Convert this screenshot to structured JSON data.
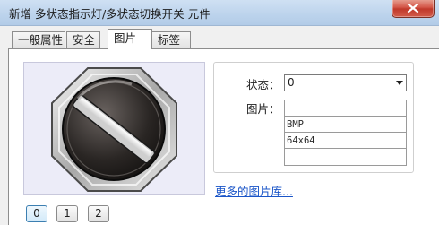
{
  "window": {
    "title": "新增 多状态指示灯/多状态切换开关 元件"
  },
  "tabs": [
    {
      "label": "一般属性"
    },
    {
      "label": "安全"
    },
    {
      "label": "图片"
    },
    {
      "label": "标签"
    }
  ],
  "active_tab": "图片",
  "picture": {
    "state_label": "状态：",
    "state_value": "0",
    "picture_label": "图片：",
    "info_lines": [
      "",
      "BMP",
      "64x64",
      ""
    ]
  },
  "more_link": "更多的图片库...",
  "state_buttons": [
    "0",
    "1",
    "2"
  ],
  "colors": {
    "titlebar": "#bcd3ec",
    "close_button": "#c0392b",
    "link": "#1a55c8",
    "preview_bg": "#ececf8"
  },
  "icons": {
    "close": "close-icon",
    "dropdown": "chevron-down-icon",
    "switch_image": "rotary-switch-icon"
  }
}
